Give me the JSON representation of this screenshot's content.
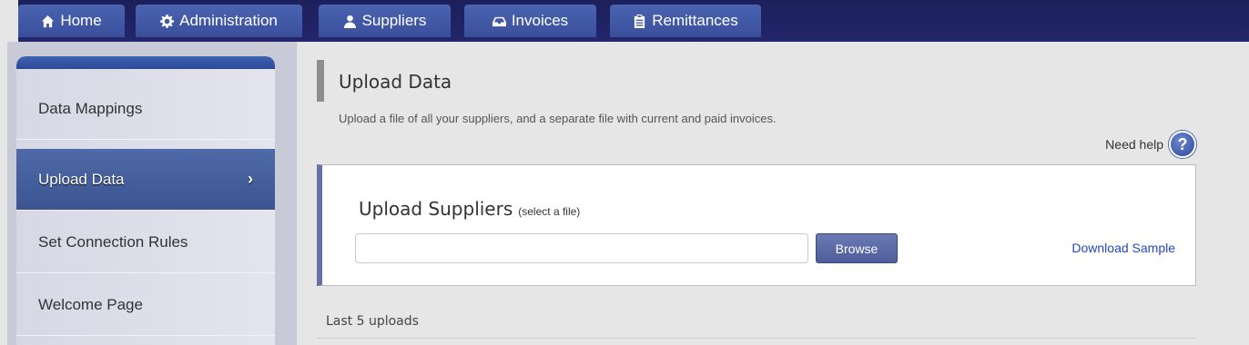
{
  "nav": {
    "tabs": [
      {
        "label": "Home",
        "icon": "home-icon"
      },
      {
        "label": "Administration",
        "icon": "gear-icon"
      },
      {
        "label": "Suppliers",
        "icon": "user-icon"
      },
      {
        "label": "Invoices",
        "icon": "inbox-icon"
      },
      {
        "label": "Remittances",
        "icon": "clipboard-icon"
      }
    ]
  },
  "sidebar": {
    "items": [
      {
        "label": "Data Mappings"
      },
      {
        "label": "Upload Data",
        "active": true
      },
      {
        "label": "Set Connection Rules"
      },
      {
        "label": "Welcome Page"
      }
    ],
    "active_chevron": "›"
  },
  "main": {
    "title": "Upload Data",
    "subtitle": "Upload a file of all your suppliers, and a separate file with current and paid invoices.",
    "help_label": "Need help",
    "help_symbol": "?",
    "upload": {
      "title": "Upload Suppliers",
      "hint": "(select a file)",
      "file_value": "",
      "browse_label": "Browse",
      "download_label": "Download Sample"
    },
    "last_uploads_label": "Last 5 uploads"
  },
  "colors": {
    "nav_bg": "#1c1f5a",
    "tab_bg": "#4a63b0",
    "active_item": "#4f6aa8",
    "link": "#2546c3"
  }
}
